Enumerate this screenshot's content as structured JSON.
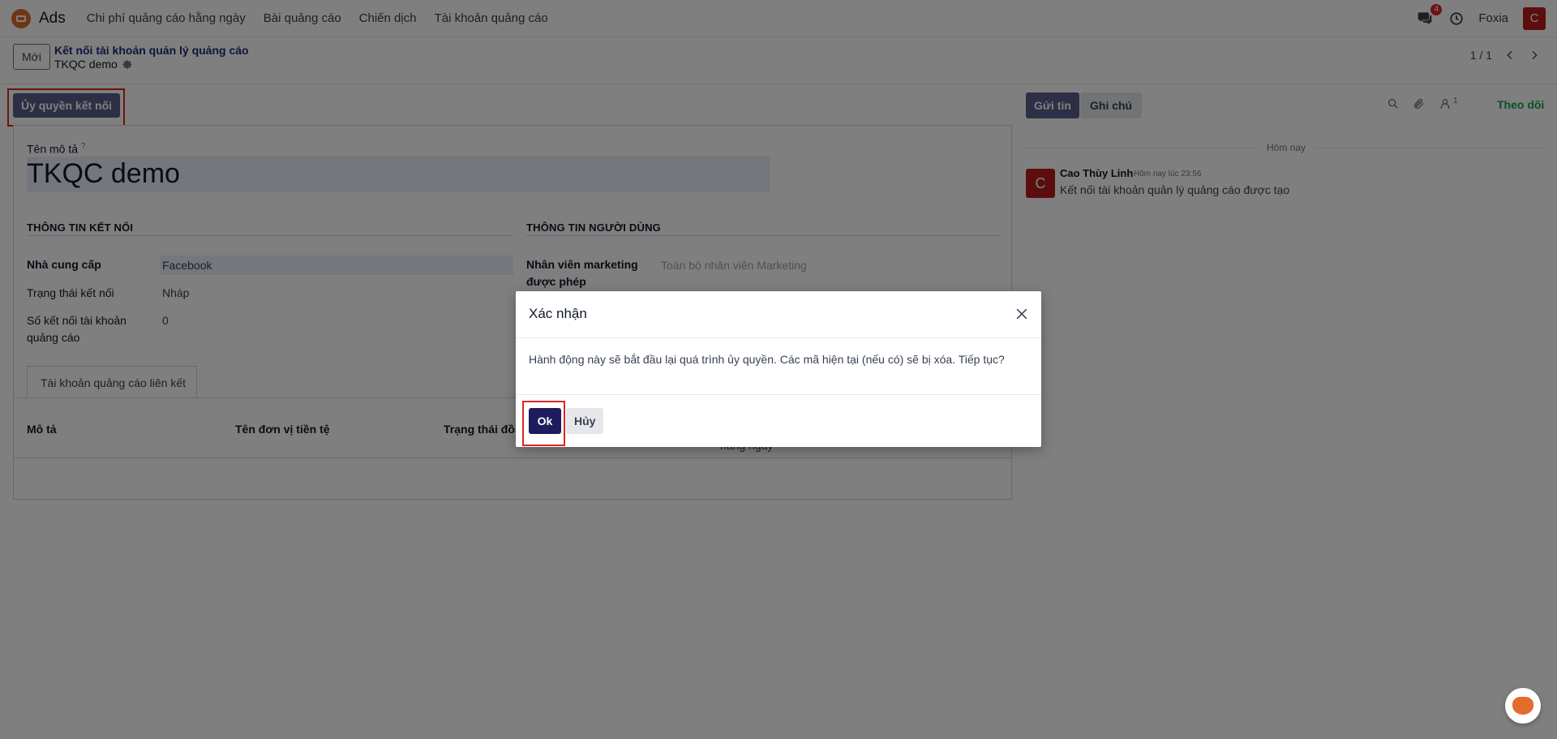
{
  "navbar": {
    "app_name": "Ads",
    "menu": [
      {
        "label": "Chi phí quảng cáo hằng ngày"
      },
      {
        "label": "Bài quảng cáo"
      },
      {
        "label": "Chiến dịch"
      },
      {
        "label": "Tài khoản quảng cáo"
      }
    ],
    "messages_badge": "4",
    "company": "Foxia",
    "user_initial": "C"
  },
  "control_panel": {
    "new_label": "Mới",
    "breadcrumb_parent": "Kết nối tài khoản quản lý quảng cáo",
    "breadcrumb_current": "TKQC demo",
    "pager": "1 / 1"
  },
  "actions": {
    "authorize_label": "Ủy quyền kết nối"
  },
  "form": {
    "name_label": "Tên mô tả",
    "name_help": "?",
    "name_value": "TKQC demo",
    "connection_section": "THÔNG TIN KẾT NỐI",
    "user_section": "THÔNG TIN NGƯỜI DÙNG",
    "provider_label": "Nhà cung cấp",
    "provider_value": "Facebook",
    "status_label": "Trạng thái kết nối",
    "status_value": "Nháp",
    "count_label_1": "Số kết nối tài khoản",
    "count_label_2": "quảng cáo",
    "count_value": "0",
    "marketing_label_1": "Nhân viên marketing",
    "marketing_label_2": "được phép",
    "marketing_placeholder": "Toàn bộ nhân viên Marketing",
    "tab_label": "Tài khoản quảng cáo liên kết",
    "table_columns": [
      "Mô tả",
      "Tên đơn vị tiền tệ",
      "Trạng thái đồn"
    ],
    "table_partial_header": "hằng ngày"
  },
  "chatter": {
    "send_label": "Gửi tin",
    "note_label": "Ghi chú",
    "follower_count": "1",
    "follow_label": "Theo dõi",
    "today_label": "Hôm nay",
    "message": {
      "avatar_initial": "C",
      "author": "Cao Thùy Linh",
      "time": "Hôm nay lúc 23:56",
      "body": "Kết nối tài khoản quản lý quảng cáo được tạo"
    }
  },
  "dialog": {
    "title": "Xác nhận",
    "body": "Hành động này sẽ bắt đầu lại quá trình ủy quyền. Các mã hiện tại (nếu có) sẽ bị xóa. Tiếp tục?",
    "ok_label": "Ok",
    "cancel_label": "Hủy"
  },
  "colors": {
    "primary": "#5a5e8f",
    "ok_button": "#1e1b5e",
    "highlight": "#dc2626",
    "follow": "#16a34a",
    "avatar": "#b91c1c"
  }
}
